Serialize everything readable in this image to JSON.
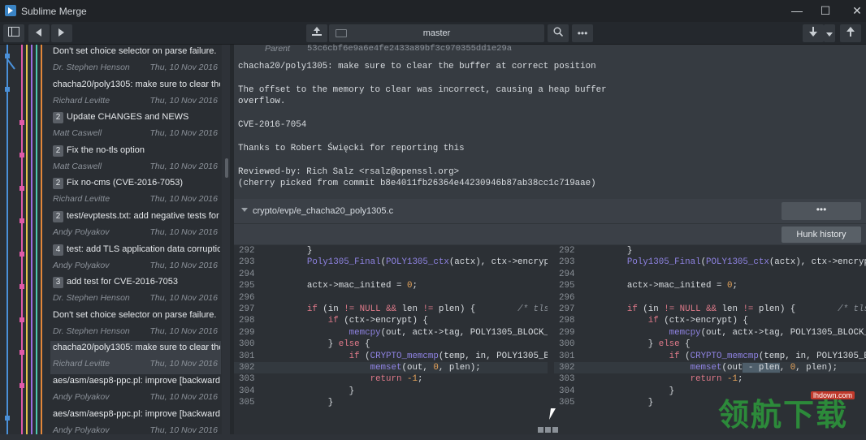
{
  "titlebar": {
    "title": "Sublime Merge",
    "minimize": "—",
    "maximize": "☐",
    "close": "✕"
  },
  "toolbar": {
    "branch": "master",
    "more": "•••"
  },
  "commits": [
    {
      "msg": "Don't set choice selector on parse failure.",
      "badge": "",
      "author": "Dr. Stephen Henson",
      "date": "Thu, 10 Nov 2016"
    },
    {
      "msg": "chacha20/poly1305: make sure to clear the",
      "badge": "",
      "author": "Richard Levitte",
      "date": "Thu, 10 Nov 2016"
    },
    {
      "msg": "Update CHANGES and NEWS",
      "badge": "2",
      "author": "Matt Caswell",
      "date": "Thu, 10 Nov 2016"
    },
    {
      "msg": "Fix the no-tls option",
      "badge": "2",
      "author": "Matt Caswell",
      "date": "Thu, 10 Nov 2016"
    },
    {
      "msg": "Fix no-cms (CVE-2016-7053)",
      "badge": "2",
      "author": "Richard Levitte",
      "date": "Thu, 10 Nov 2016"
    },
    {
      "msg": "test/evptests.txt: add negative tests for",
      "badge": "2",
      "author": "Andy Polyakov",
      "date": "Thu, 10 Nov 2016"
    },
    {
      "msg": "test: add TLS application data corruptio",
      "badge": "4",
      "author": "Andy Polyakov",
      "date": "Thu, 10 Nov 2016"
    },
    {
      "msg": "add test for CVE-2016-7053",
      "badge": "3",
      "author": "Dr. Stephen Henson",
      "date": "Thu, 10 Nov 2016"
    },
    {
      "msg": "Don't set choice selector on parse failure.",
      "badge": "",
      "author": "Dr. Stephen Henson",
      "date": "Thu, 10 Nov 2016"
    },
    {
      "msg": "chacha20/poly1305: make sure to clear the",
      "badge": "",
      "author": "Richard Levitte",
      "date": "Thu, 10 Nov 2016"
    },
    {
      "msg": "aes/asm/aesp8-ppc.pl: improve [backward]",
      "badge": "",
      "author": "Andy Polyakov",
      "date": "Thu, 10 Nov 2016"
    },
    {
      "msg": "aes/asm/aesp8-ppc.pl: improve [backward]",
      "badge": "",
      "author": "Andy Polyakov",
      "date": "Thu, 10 Nov 2016"
    }
  ],
  "detail": {
    "parent_label": "Parent",
    "parent_hash": "53c6cbf6e9a6e4fe2433a89bf3c970355dd1e29a",
    "lines": [
      "chacha20/poly1305: make sure to clear the buffer at correct position",
      "The offset to the memory to clear was incorrect, causing a heap buffer",
      "overflow.",
      "CVE-2016-7054",
      "Thanks to Robert Święcki for reporting this",
      "Reviewed-by: Rich Salz <rsalz@openssl.org>",
      "(cherry picked from commit b8e4011fb26364e44230946b87ab38cc1c719aae)"
    ]
  },
  "file": {
    "name": "crypto/evp/e_chacha20_poly1305.c",
    "more_label": "•••",
    "hunk_history": "Hunk history"
  },
  "watermark": {
    "small": "lhdown.com",
    "big": "领航下载"
  }
}
